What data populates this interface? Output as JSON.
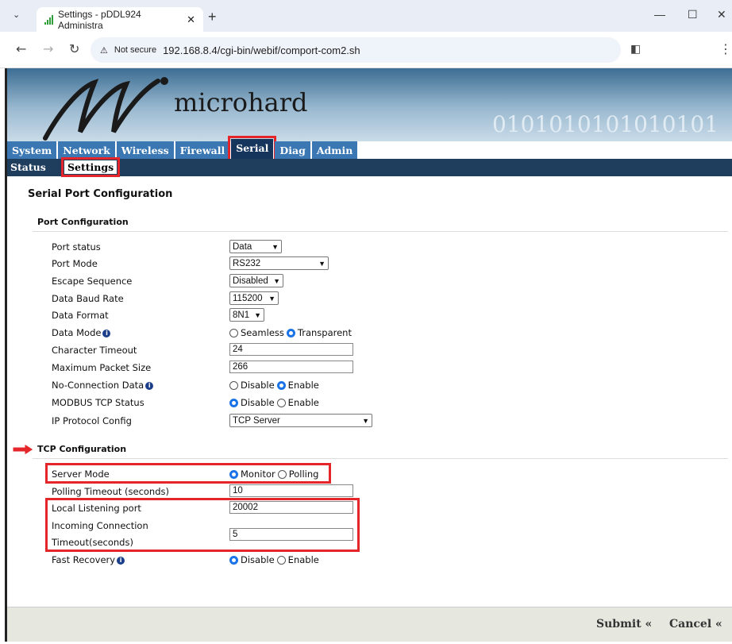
{
  "browser": {
    "tab_title": "Settings - pDDL924 Administra",
    "url": "192.168.8.4/cgi-bin/webif/comport-com2.sh",
    "security": "Not secure"
  },
  "brand": {
    "logo_text": "microhard",
    "binary_text": "0101010101010101"
  },
  "menu": {
    "items": [
      "System",
      "Network",
      "Wireless",
      "Firewall",
      "Serial",
      "Diag",
      "Admin"
    ],
    "active": "Serial"
  },
  "submenu": {
    "items": [
      "Status",
      "Settings"
    ],
    "active": "Settings"
  },
  "page": {
    "title": "Serial Port Configuration"
  },
  "port": {
    "heading": "Port Configuration",
    "port_status_label": "Port status",
    "port_status_value": "Data",
    "port_mode_label": "Port Mode",
    "port_mode_value": "RS232",
    "escape_label": "Escape Sequence",
    "escape_value": "Disabled",
    "baud_label": "Data Baud Rate",
    "baud_value": "115200",
    "format_label": "Data Format",
    "format_value": "8N1",
    "mode_label": "Data Mode",
    "mode_opt1": "Seamless",
    "mode_opt2": "Transparent",
    "char_timeout_label": "Character Timeout",
    "char_timeout_value": "24",
    "max_packet_label": "Maximum Packet Size",
    "max_packet_value": "266",
    "noconn_label": "No-Connection Data",
    "noconn_opt1": "Disable",
    "noconn_opt2": "Enable",
    "modbus_label": "MODBUS TCP Status",
    "modbus_opt1": "Disable",
    "modbus_opt2": "Enable",
    "ipproto_label": "IP Protocol Config",
    "ipproto_value": "TCP Server"
  },
  "tcp": {
    "heading": "TCP Configuration",
    "server_mode_label": "Server Mode",
    "server_opt1": "Monitor",
    "server_opt2": "Polling",
    "polling_label": "Polling Timeout (seconds)",
    "polling_value": "10",
    "listen_label": "Local Listening port",
    "listen_value": "20002",
    "incoming_label_1": "Incoming Connection",
    "incoming_label_2": "Timeout(seconds)",
    "incoming_value": "5",
    "fast_label": "Fast Recovery",
    "fast_opt1": "Disable",
    "fast_opt2": "Enable"
  },
  "footer": {
    "submit": "Submit «",
    "cancel": "Cancel «"
  }
}
